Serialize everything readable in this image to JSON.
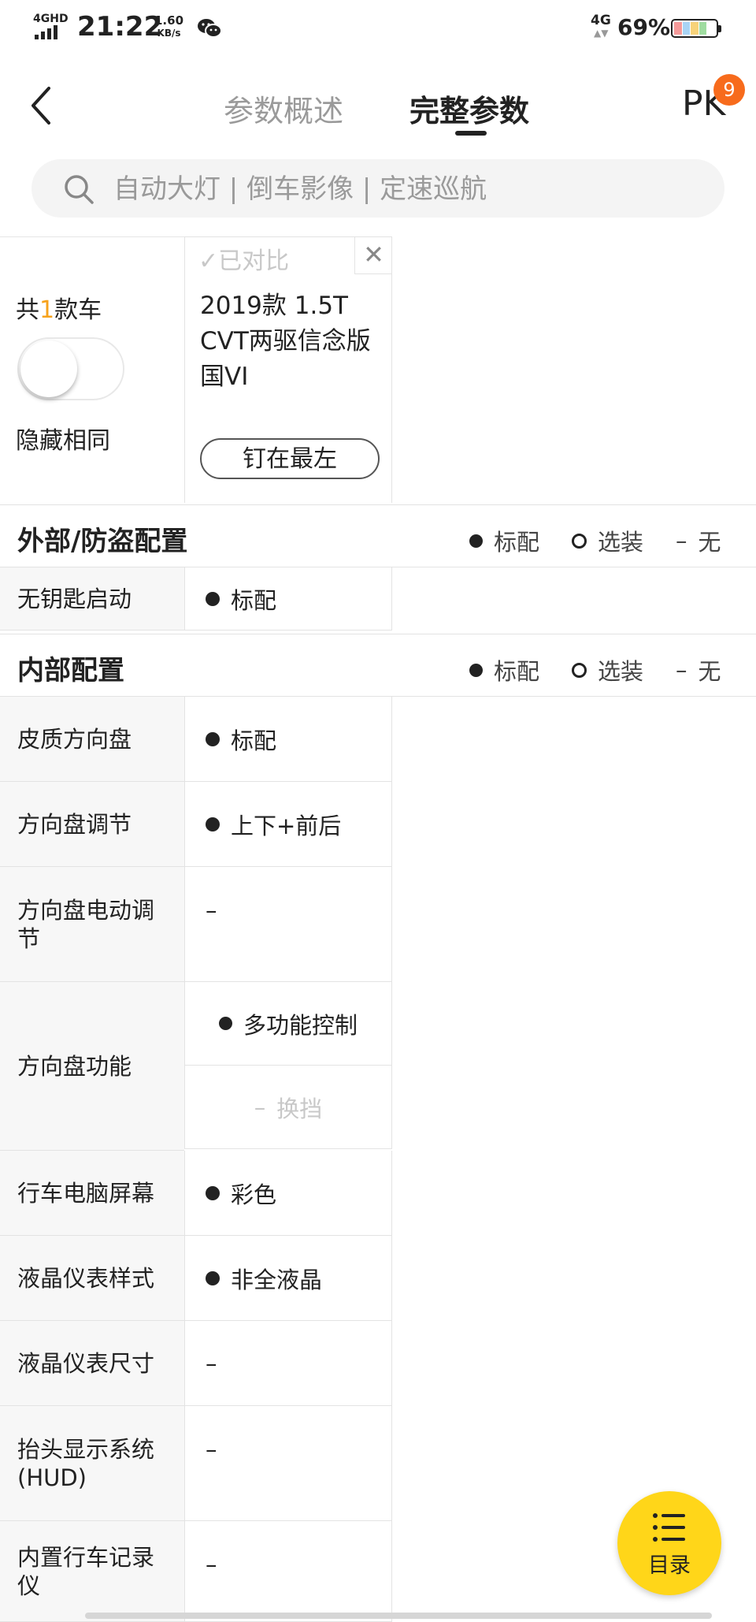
{
  "status_bar": {
    "network_label": "4GHD",
    "time": "21:22",
    "speed_value": "1.60",
    "speed_unit": "KB/s",
    "net_right": "4G",
    "battery_pct": "69%"
  },
  "nav": {
    "tab_overview": "参数概述",
    "tab_full": "完整参数",
    "pk_label": "PK",
    "pk_count": "9"
  },
  "search": {
    "placeholder": "自动大灯 | 倒车影像 | 定速巡航"
  },
  "compare": {
    "count_prefix": "共",
    "count_num": "1",
    "count_suffix": "款车",
    "hide_same_label": "隐藏相同",
    "hide_same_enabled": false,
    "compared_label": "已对比",
    "car_name": "2019款 1.5T CVT两驱信念版 国VI",
    "pin_label": "钉在最左"
  },
  "legend": {
    "standard": "标配",
    "optional": "选装",
    "none": "无",
    "none_mark": "–"
  },
  "sections": {
    "exterior": {
      "title": "外部/防盗配置",
      "rows": [
        {
          "label": "无钥匙启动",
          "value": "标配"
        }
      ]
    },
    "interior": {
      "title": "内部配置",
      "rows": [
        {
          "label": "皮质方向盘",
          "value": "标配"
        },
        {
          "label": "方向盘调节",
          "value": "上下+前后"
        },
        {
          "label": "方向盘电动调节",
          "value": "–"
        },
        {
          "label": "方向盘功能",
          "value_1": "多功能控制",
          "value_2": "换挡",
          "value_2_mark": "–"
        },
        {
          "label": "行车电脑屏幕",
          "value": "彩色"
        },
        {
          "label": "液晶仪表样式",
          "value": "非全液晶"
        },
        {
          "label": "液晶仪表尺寸",
          "value": "–"
        },
        {
          "label": "抬头显示系统(HUD)",
          "value": "–"
        },
        {
          "label": "内置行车记录仪",
          "value": "–"
        }
      ]
    }
  },
  "fab": {
    "label": "目录"
  },
  "colors": {
    "accent": "#f7a21b",
    "badge": "#f76b1c",
    "fab": "#ffd619",
    "muted": "#9a9a9a"
  },
  "icons": [
    "signal-icon",
    "wechat-icon",
    "battery-icon",
    "back-arrow-icon",
    "search-icon",
    "check-icon",
    "close-icon",
    "menu-list-icon"
  ]
}
